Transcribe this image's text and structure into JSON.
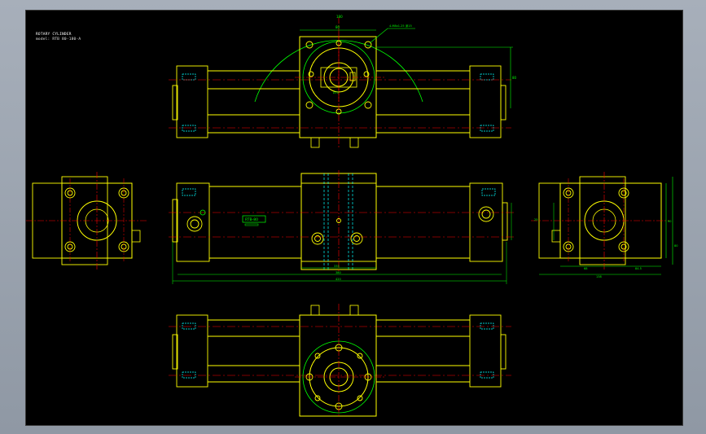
{
  "drawing": {
    "title_line1": "ROTARY CYLINDER",
    "title_line2": "model: RTB 80-180-A",
    "callout_note": "4-M8x1.25 深15",
    "nameplate": "RTB-80",
    "dims": {
      "top_radius": "180",
      "top_flange": "80",
      "top_height": "80",
      "top_hub": "Ø72",
      "front_a": "335",
      "front_b": "380",
      "front_c": "420",
      "right_a": "68",
      "right_b": "84.5",
      "right_c": "138",
      "right_d": "90",
      "right_e": "80",
      "right_f": "25"
    }
  },
  "colors": {
    "background": "#000000",
    "outline": "#ffff00",
    "center": "#ff0000",
    "dimension": "#00ff00",
    "hidden": "#00ffff",
    "text": "#ffffff"
  }
}
